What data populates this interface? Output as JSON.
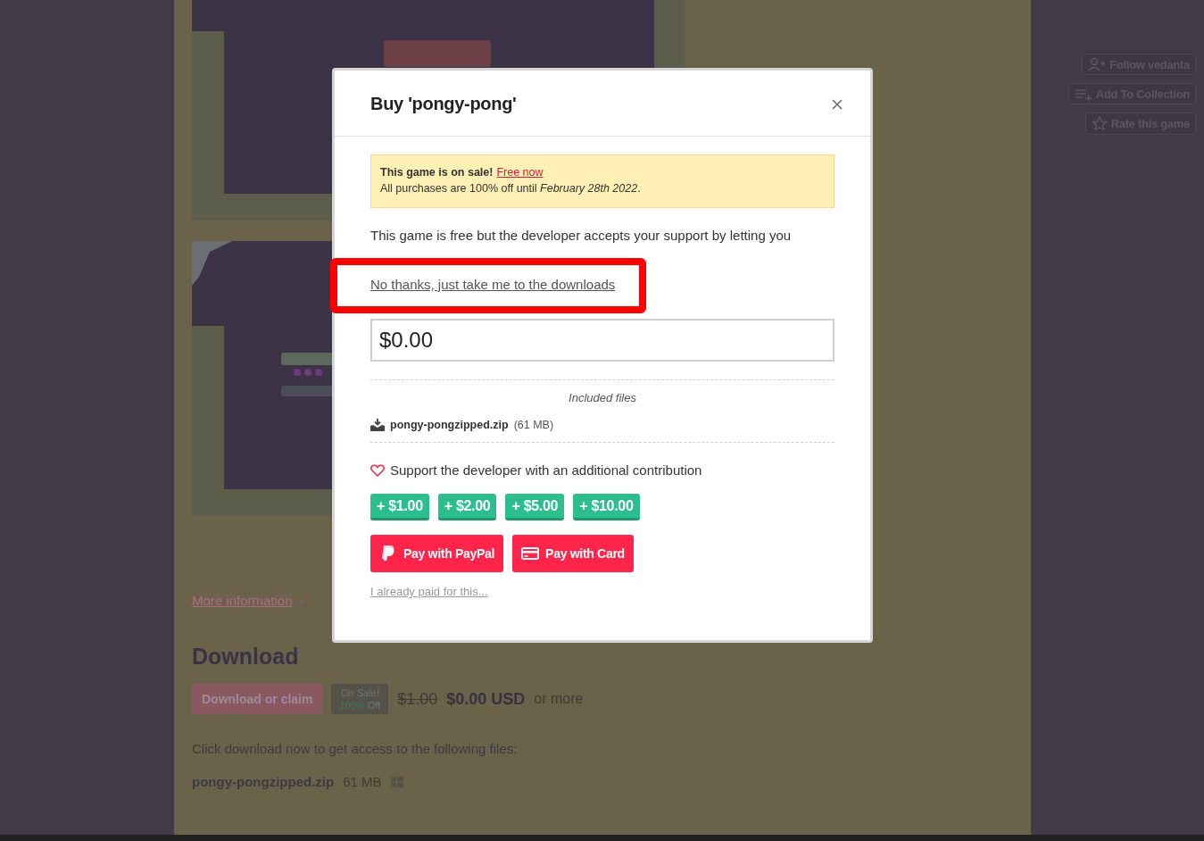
{
  "page": {
    "more_information": "More information",
    "download": {
      "heading": "Download",
      "button": "Download or claim",
      "sale_badge": {
        "line_1": "On Sale!",
        "percent": "100%",
        "off": "Off"
      },
      "original_price": "$1.00",
      "price": "$0.00 USD",
      "price_suffix": "or more",
      "instructions": "Click download now to get access to the following files:",
      "files": [
        {
          "name": "pongy-pongzipped.zip",
          "size": "61 MB"
        }
      ]
    }
  },
  "actions": [
    {
      "kind": "follow",
      "label": "Follow vedanta"
    },
    {
      "kind": "collection",
      "label": "Add To Collection"
    },
    {
      "kind": "rate",
      "label": "Rate this game"
    }
  ],
  "modal": {
    "title": "Buy 'pongy-pong'",
    "sale_notice": {
      "headline": "This game is on sale!",
      "link": "Free now",
      "details": "All purchases are 100% off until *February 28th 2022*."
    },
    "description": "This game is free but the developer accepts your support by letting you",
    "skip_link": "No thanks, just take me to the downloads",
    "price_input": {
      "value": "$0.00"
    },
    "included_files": {
      "heading": "Included files",
      "files": [
        {
          "name": "pongy-pongzipped.zip",
          "size": "(61 MB)"
        }
      ]
    },
    "support": {
      "text": "Support the developer with an additional contribution",
      "amounts": [
        "+ $1.00",
        "+ $2.00",
        "+ $5.00",
        "+ $10.00"
      ]
    },
    "payment_buttons": [
      {
        "kind": "paypal",
        "label": "Pay with PayPal"
      },
      {
        "kind": "card",
        "label": "Pay with Card"
      }
    ],
    "already_paid": "I already paid for this..."
  }
}
